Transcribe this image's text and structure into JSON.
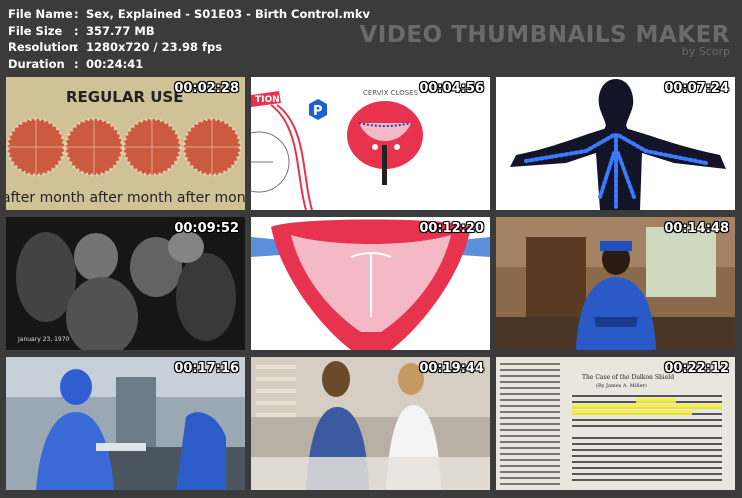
{
  "file_info": {
    "rows": [
      {
        "key": "File Name",
        "value": "Sex, Explained - S01E03 - Birth Control.mkv"
      },
      {
        "key": "File Size",
        "value": "357.77 MB"
      },
      {
        "key": "Resolution",
        "value": "1280x720 / 23.98 fps"
      },
      {
        "key": "Duration",
        "value": "00:24:41"
      }
    ],
    "separator": ":"
  },
  "brand": {
    "title": "VIDEO THUMBNAILS MAKER",
    "subtitle": "by Scorp"
  },
  "thumbnails": [
    {
      "timestamp": "00:02:28",
      "caption": "REGULAR USE",
      "footer": "after month after month after month a"
    },
    {
      "timestamp": "00:04:56",
      "caption": "CERVIX CLOSES",
      "corner_label": "TION",
      "badge": "P"
    },
    {
      "timestamp": "00:07:24"
    },
    {
      "timestamp": "00:09:52",
      "caption": "January 23, 1970"
    },
    {
      "timestamp": "00:12:20"
    },
    {
      "timestamp": "00:14:48"
    },
    {
      "timestamp": "00:17:16"
    },
    {
      "timestamp": "00:19:44"
    },
    {
      "timestamp": "00:22:12",
      "headline": "The Case of the Dalkon Shield",
      "byline": "(By James A. Miller)"
    }
  ],
  "colors": {
    "background": "#3b3b3b",
    "text": "#ffffff",
    "brand": "#6a6a6a"
  }
}
